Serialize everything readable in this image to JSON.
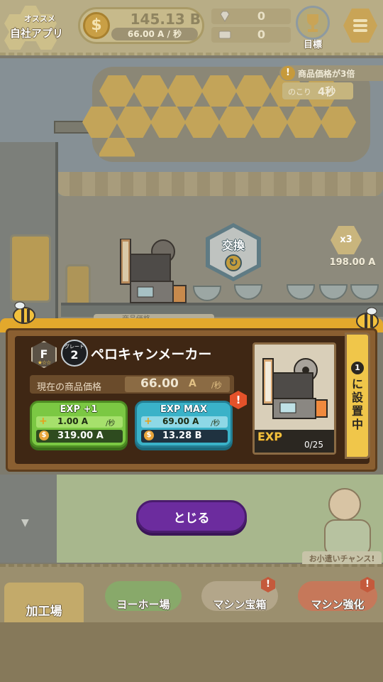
{
  "hud": {
    "ad_label_top": "オススメ",
    "ad_label_bottom": "自社アプリ",
    "money_value": "145.13 B",
    "money_rate": "66.00 A / 秒",
    "gems": "0",
    "tickets": "0",
    "goal_label": "目標"
  },
  "scene": {
    "bonus_text": "商品価格が3倍",
    "timer_label": "のこり",
    "timer_value": "4秒",
    "exchange_label": "交換",
    "multiplier": "x3",
    "multiplier_value": "198.00 A",
    "price_tag": "商品価格"
  },
  "dialog": {
    "rank": "F",
    "grade_label": "グレード",
    "grade_value": "2",
    "machine_name": "ペロキャンメーカー",
    "price_label": "現在の商品価格",
    "price_value": "66.00",
    "price_unit": "A",
    "price_per": "/秒",
    "exp1": {
      "title": "EXP +1",
      "rate": "1.00 A",
      "rate_unit": "/秒",
      "cost": "319.00 A"
    },
    "expmax": {
      "title": "EXP MAX",
      "rate": "69.00 A",
      "rate_unit": "/秒",
      "cost": "13.28 B"
    },
    "exp_label": "EXP",
    "exp_progress": "0/25",
    "exp_fraction": 0,
    "place_num": "1",
    "place_text": "に設置中",
    "alert": "!"
  },
  "lower": {
    "close_label": "とじる",
    "npc_sign": "お小遣いチャンス!"
  },
  "nav": {
    "factory": "加工場",
    "yoho": "ヨーホー場",
    "box": "マシン宝箱",
    "boost": "マシン強化"
  },
  "colors": {
    "upgrade_green": "#7bc843",
    "upgrade_blue": "#3ab2c8",
    "close_purple": "#6c2c9e",
    "honey": "#e3a82c",
    "dialog_brown": "#8a5f31"
  }
}
